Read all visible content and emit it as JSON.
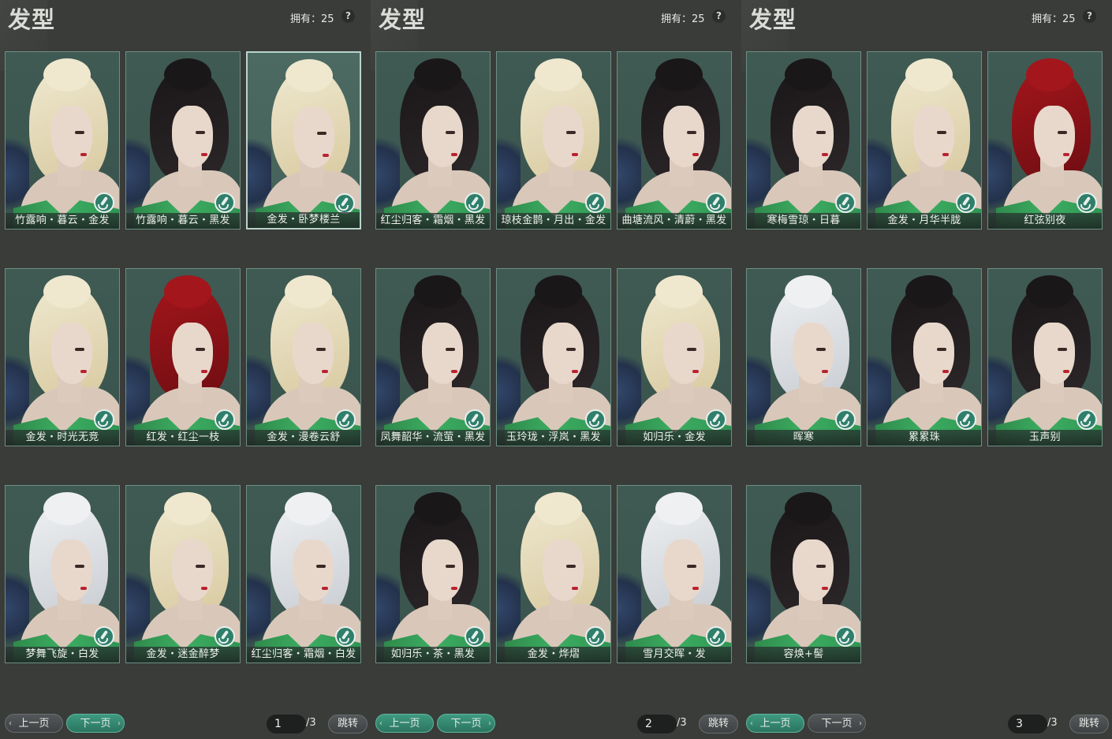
{
  "colors": {
    "card_bg": "#3f5a53",
    "card_border": "#6d8f83",
    "selected_border": "#b9d4cb",
    "accent_button": "#3e9a80",
    "dress_green": "#3cae61"
  },
  "panels": [
    {
      "title": "发型",
      "owned": "拥有：25",
      "help": "?",
      "cards": [
        {
          "label": "竹露响・暮云・金发",
          "hair": "blonde",
          "selected": false
        },
        {
          "label": "竹露响・暮云・黑发",
          "hair": "black",
          "selected": false
        },
        {
          "label": "金发・卧梦楼兰",
          "hair": "blonde",
          "selected": true
        },
        {
          "label": "金发・时光无竞",
          "hair": "blonde",
          "selected": false
        },
        {
          "label": "红发・红尘一枝",
          "hair": "red",
          "selected": false
        },
        {
          "label": "金发・漫卷云舒",
          "hair": "blonde",
          "selected": false
        },
        {
          "label": "梦舞飞旋・白发",
          "hair": "white",
          "selected": false
        },
        {
          "label": "金发・迷金醉梦",
          "hair": "blonde",
          "selected": false
        },
        {
          "label": "红尘归客・霜烟・白发",
          "hair": "white",
          "selected": false
        }
      ],
      "prev": "上一页",
      "next": "下一页",
      "active_button": "next",
      "page": "1",
      "total": "/3",
      "jump": "跳转"
    },
    {
      "title": "发型",
      "owned": "拥有：25",
      "help": "?",
      "cards": [
        {
          "label": "红尘归客・霜烟・黑发",
          "hair": "black",
          "selected": false
        },
        {
          "label": "琼枝金鹊・月出・金发",
          "hair": "blonde",
          "selected": false
        },
        {
          "label": "曲塘流风・清蔚・黑发",
          "hair": "black",
          "selected": false
        },
        {
          "label": "凤舞韶华・流萤・黑发",
          "hair": "black",
          "selected": false
        },
        {
          "label": "玉玲珑・浮岚・黑发",
          "hair": "black",
          "selected": false
        },
        {
          "label": "如归乐・金发",
          "hair": "blonde",
          "selected": false
        },
        {
          "label": "如归乐・茶・黑发",
          "hair": "black",
          "selected": false
        },
        {
          "label": "金发・烨熠",
          "hair": "blonde",
          "selected": false
        },
        {
          "label": "雪月交晖・发",
          "hair": "white",
          "selected": false
        }
      ],
      "prev": "上一页",
      "next": "下一页",
      "active_button": "both",
      "page": "2",
      "total": "/3",
      "jump": "跳转"
    },
    {
      "title": "发型",
      "owned": "拥有：25",
      "help": "?",
      "cards": [
        {
          "label": "寒梅雪琼・日暮",
          "hair": "black",
          "selected": false
        },
        {
          "label": "金发・月华半胧",
          "hair": "blonde",
          "selected": false
        },
        {
          "label": "红弦别夜",
          "hair": "red",
          "selected": false
        },
        {
          "label": "晖寒",
          "hair": "white",
          "selected": false
        },
        {
          "label": "累累珠",
          "hair": "black",
          "selected": false
        },
        {
          "label": "玉声别",
          "hair": "black",
          "selected": false
        },
        {
          "label": "容焕+髻",
          "hair": "black",
          "selected": false
        }
      ],
      "prev": "上一页",
      "next": "下一页",
      "active_button": "prev",
      "page": "3",
      "total": "/3",
      "jump": "跳转"
    }
  ]
}
